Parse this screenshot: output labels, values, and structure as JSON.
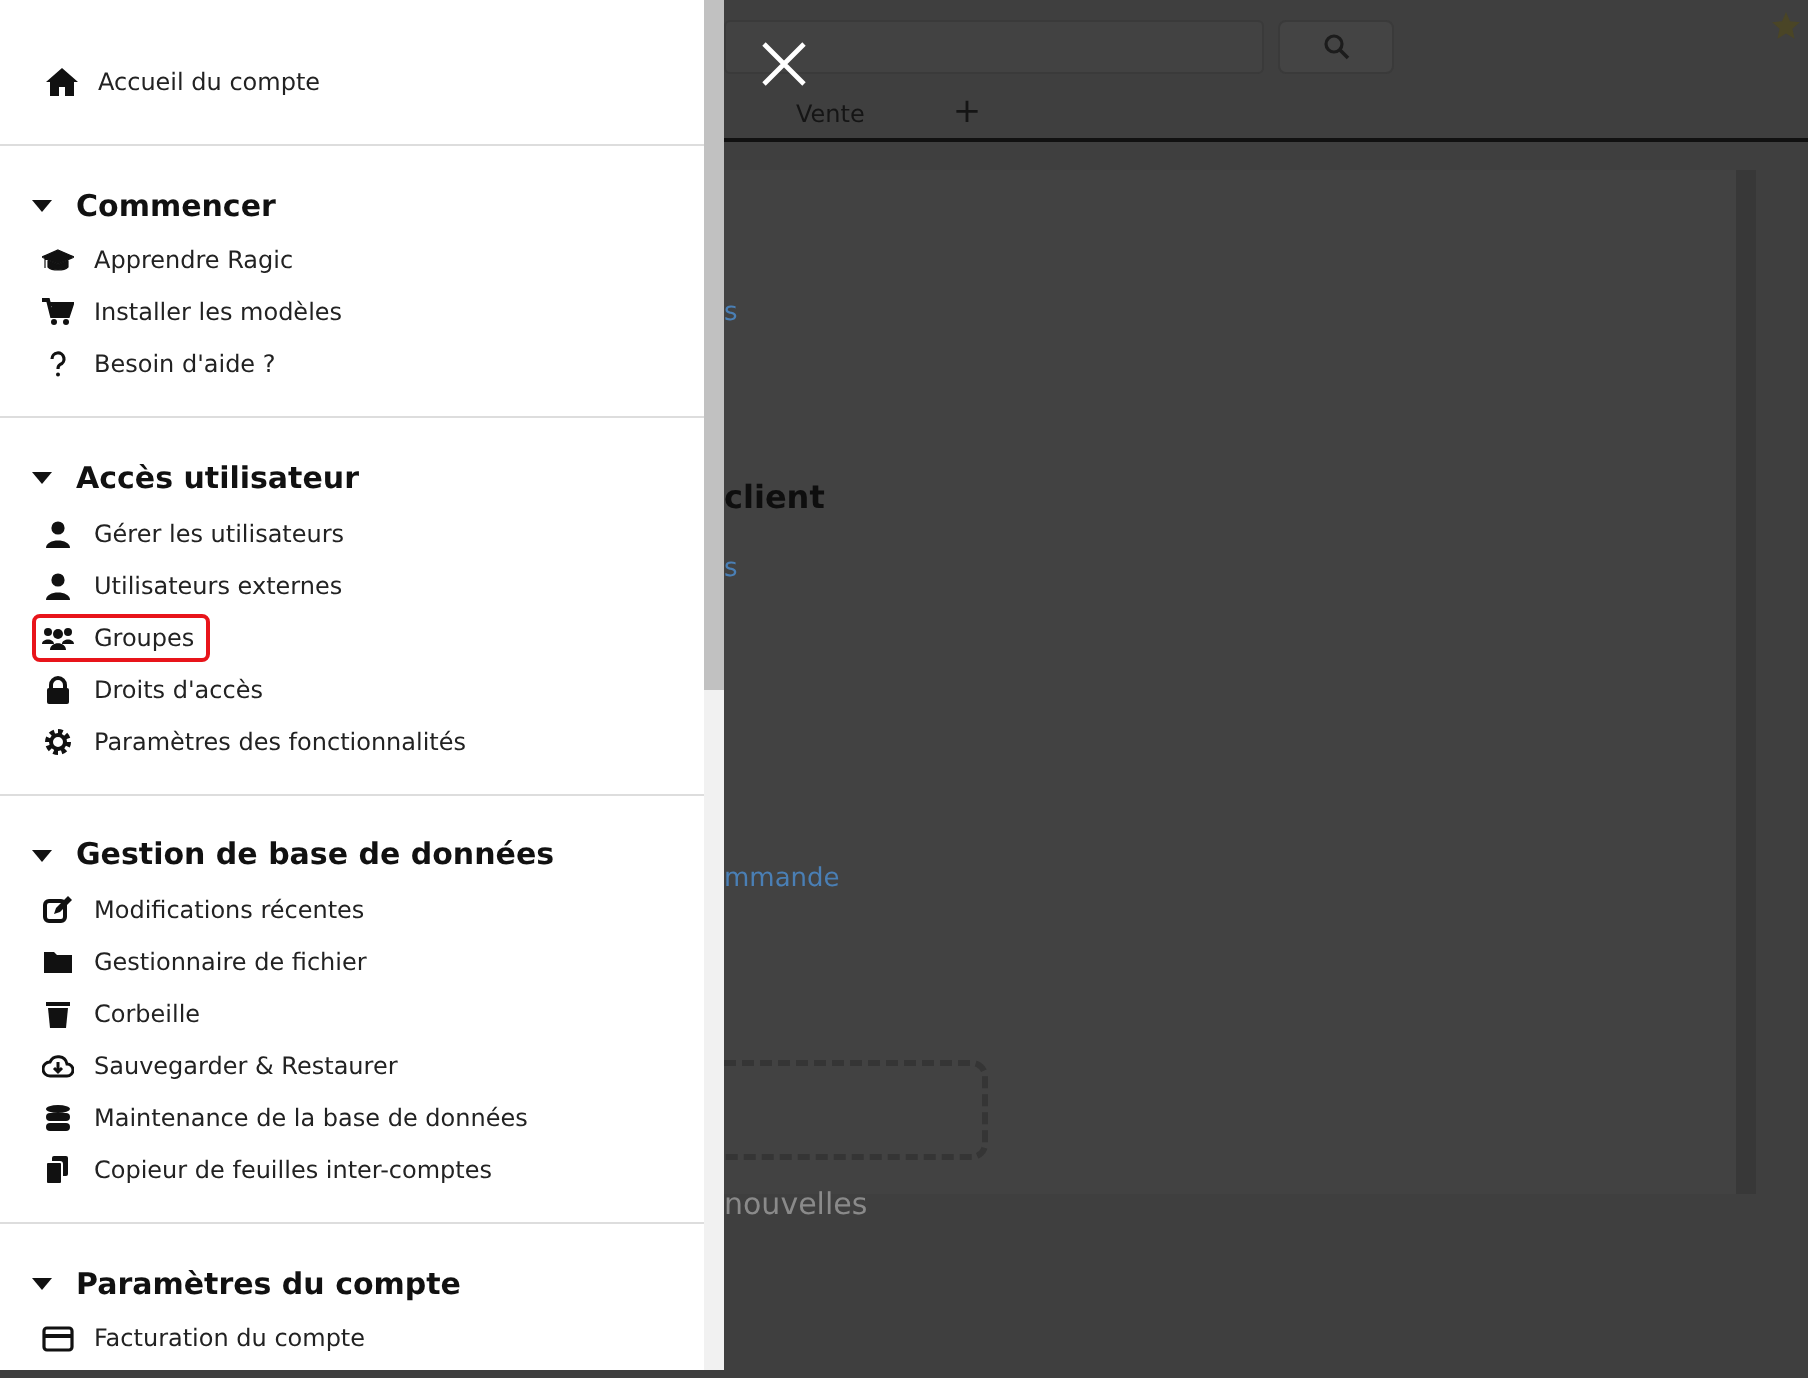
{
  "sidebar": {
    "home": {
      "label": "Accueil du compte"
    },
    "sections": [
      {
        "title": "Commencer",
        "expanded": true,
        "items": [
          {
            "label": "Apprendre Ragic",
            "highlighted": false
          },
          {
            "label": "Installer les modèles",
            "highlighted": false
          },
          {
            "label": "Besoin d'aide ?",
            "highlighted": false
          }
        ]
      },
      {
        "title": "Accès utilisateur",
        "expanded": true,
        "items": [
          {
            "label": "Gérer les utilisateurs",
            "highlighted": false
          },
          {
            "label": "Utilisateurs externes",
            "highlighted": false
          },
          {
            "label": "Groupes",
            "highlighted": true
          },
          {
            "label": "Droits d'accès",
            "highlighted": false
          },
          {
            "label": "Paramètres des fonctionnalités",
            "highlighted": false
          }
        ]
      },
      {
        "title": "Gestion de base de données",
        "expanded": true,
        "items": [
          {
            "label": "Modifications récentes",
            "highlighted": false
          },
          {
            "label": "Gestionnaire de fichier",
            "highlighted": false
          },
          {
            "label": "Corbeille",
            "highlighted": false
          },
          {
            "label": "Sauvegarder & Restaurer",
            "highlighted": false
          },
          {
            "label": "Maintenance de la base de données",
            "highlighted": false
          },
          {
            "label": "Copieur de feuilles inter-comptes",
            "highlighted": false
          }
        ]
      },
      {
        "title": "Paramètres du compte",
        "expanded": true,
        "items": [
          {
            "label": "Facturation du compte",
            "highlighted": false
          }
        ]
      }
    ]
  },
  "background": {
    "tabs": [
      {
        "label": "Vente"
      },
      {
        "label": "+"
      }
    ],
    "content": [
      {
        "kind": "link",
        "text": "s"
      },
      {
        "kind": "heading",
        "text": "client"
      },
      {
        "kind": "link",
        "text": "s"
      },
      {
        "kind": "link",
        "text": "mmande"
      },
      {
        "kind": "dropzone"
      },
      {
        "kind": "hint",
        "text": "nouvelles"
      }
    ]
  }
}
